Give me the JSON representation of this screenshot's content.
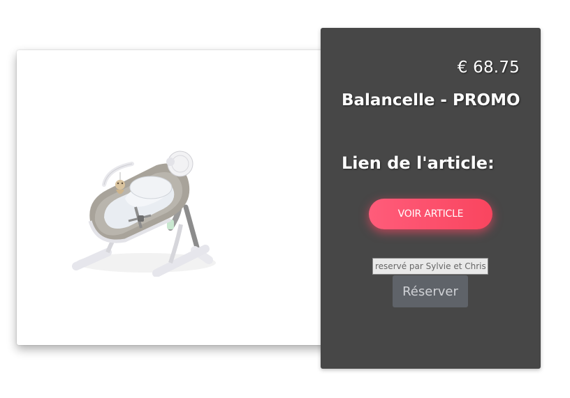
{
  "product": {
    "price": "€ 68.75",
    "title": "Balancelle - PROMO",
    "link_heading": "Lien de l'article:",
    "voir_button_label": "VOIR ARTICLE",
    "image_icon": "baby-swing-photo"
  },
  "reservation": {
    "input_placeholder": "reservé par Sylvie et Christophe",
    "reserve_button_label": "Réserver"
  },
  "colors": {
    "panel_background": "#474747",
    "accent_button": "#f9455f",
    "reserve_button": "#5f6369"
  }
}
